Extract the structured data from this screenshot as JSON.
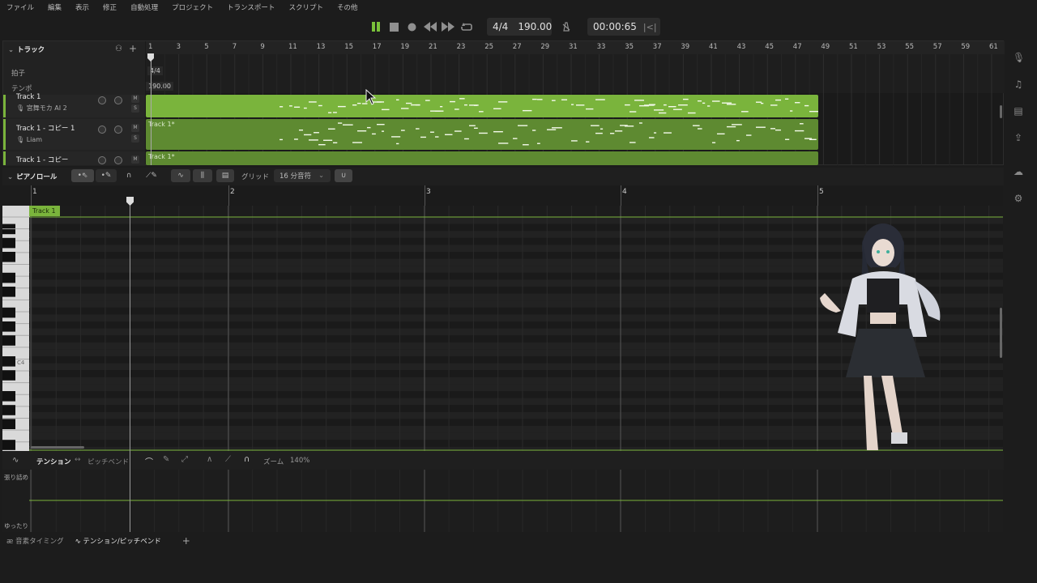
{
  "menu": [
    "ファイル",
    "編集",
    "表示",
    "修正",
    "自動処理",
    "プロジェクト",
    "トランスポート",
    "スクリプト",
    "その他"
  ],
  "transport": {
    "time_signature": "4/4",
    "tempo": "190.00",
    "time": "00:00:65",
    "play_state": "playing",
    "accent": "#7ac13a"
  },
  "track_panel": {
    "title": "トラック",
    "ruler_marks": [
      "1",
      "3",
      "5",
      "7",
      "9",
      "11",
      "13",
      "15",
      "17",
      "19",
      "21",
      "23",
      "25",
      "27",
      "29",
      "31",
      "33",
      "35",
      "37",
      "39",
      "41",
      "43",
      "45",
      "47",
      "49",
      "51",
      "53",
      "55",
      "57",
      "59",
      "61"
    ],
    "rows": {
      "meter_label": "拍子",
      "meter_value": "4/4",
      "tempo_label": "テンポ",
      "tempo_value": "190.00"
    },
    "tracks": [
      {
        "name": "Track 1",
        "voice": "宮舞モカ AI 2",
        "m": "M",
        "s": "S",
        "clip": ""
      },
      {
        "name": "Track 1 - コピー 1",
        "voice": "Liam",
        "m": "M",
        "s": "S",
        "clip": "Track 1*"
      },
      {
        "name": "Track 1 - コピー",
        "voice": "",
        "m": "M",
        "s": "",
        "clip": "Track 1*"
      }
    ],
    "lane_color": "#7ab43c"
  },
  "piano_roll": {
    "title": "ピアノロール",
    "grid_label": "グリッド",
    "grid_value": "16 分音符",
    "bars": [
      "1",
      "2",
      "3",
      "4",
      "5"
    ],
    "clip_label": "Track 1",
    "key_label": "C4"
  },
  "tension": {
    "mode_label": "テンション",
    "alt_label": "ピッチベンド",
    "zoom_label": "ズーム",
    "zoom_value": "140%",
    "top_label": "張り詰め",
    "bottom_label": "ゆったり"
  },
  "bottom_tabs": [
    "音素タイミング",
    "テンション/ピッチベンド"
  ],
  "add_tab": "+",
  "sidebar_icons": [
    "microphone-icon",
    "music-note-icon",
    "notebook-icon",
    "export-icon",
    "cloud-icon",
    "settings-icon"
  ]
}
